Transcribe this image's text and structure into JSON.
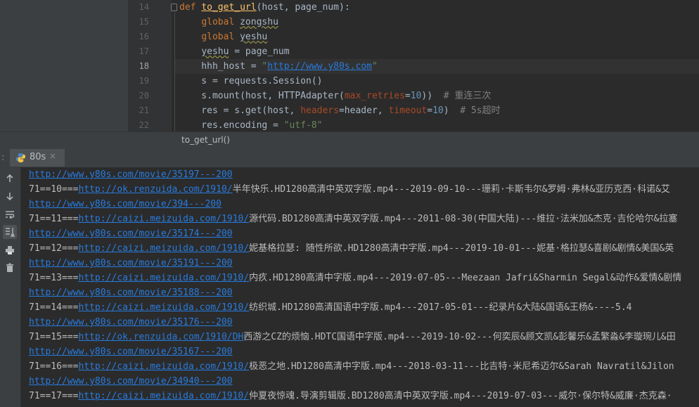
{
  "editor": {
    "lines": [
      {
        "num": "14",
        "tokens": [
          [
            "kw",
            "def "
          ],
          [
            "fn",
            "to_get_url"
          ],
          [
            "plain",
            "(host, page_num):"
          ]
        ]
      },
      {
        "num": "15",
        "tokens": [
          [
            "plain",
            "    "
          ],
          [
            "kw",
            "global "
          ],
          [
            "glob",
            "zongshu"
          ]
        ]
      },
      {
        "num": "16",
        "tokens": [
          [
            "plain",
            "    "
          ],
          [
            "kw",
            "global "
          ],
          [
            "glob",
            "yeshu"
          ]
        ]
      },
      {
        "num": "17",
        "tokens": [
          [
            "plain",
            "    "
          ],
          [
            "glob",
            "yeshu"
          ],
          [
            "plain",
            " = page_num"
          ]
        ]
      },
      {
        "num": "18",
        "current": true,
        "tokens": [
          [
            "plain",
            "    hhh_host = "
          ],
          [
            "str",
            "\""
          ],
          [
            "url",
            "http://www.y80s.com"
          ],
          [
            "str",
            "\""
          ]
        ]
      },
      {
        "num": "19",
        "tokens": [
          [
            "plain",
            "    s = requests.Session()"
          ]
        ]
      },
      {
        "num": "20",
        "tokens": [
          [
            "plain",
            "    s.mount(host, HTTPAdapter("
          ],
          [
            "param",
            "max_retries"
          ],
          [
            "plain",
            "="
          ],
          [
            "num",
            "10"
          ],
          [
            "plain",
            "))  "
          ],
          [
            "cmt",
            "# 重连三次"
          ]
        ]
      },
      {
        "num": "21",
        "tokens": [
          [
            "plain",
            "    res = s.get(host, "
          ],
          [
            "param",
            "headers"
          ],
          [
            "plain",
            "=header, "
          ],
          [
            "param",
            "timeout"
          ],
          [
            "plain",
            "="
          ],
          [
            "num",
            "10"
          ],
          [
            "plain",
            ")  "
          ],
          [
            "cmt",
            "# 5s超时"
          ]
        ]
      },
      {
        "num": "22",
        "tokens": [
          [
            "plain",
            "    res.encoding = "
          ],
          [
            "str",
            "\"utf-8\""
          ]
        ]
      }
    ]
  },
  "breadcrumb": "to_get_url()",
  "run_tab": {
    "label": "80s",
    "close": "×"
  },
  "toolbar": [
    "up-arrow-icon",
    "down-arrow-icon",
    "soft-wrap-icon",
    "scroll-to-end-icon",
    "print-icon",
    "trash-icon"
  ],
  "console": [
    [
      [
        "link",
        "http://www.y80s.com/movie/35197---200"
      ]
    ],
    [
      [
        "text",
        "71==10==="
      ],
      [
        "link",
        "http://ok.renzuida.com/1910/"
      ],
      [
        "text",
        "半年快乐.HD1280高清中英双字版.mp4---2019-09-10---珊莉·卡斯韦尔&罗姆·弗林&亚历克西·科诺&艾"
      ]
    ],
    [
      [
        "link",
        "http://www.y80s.com/movie/394---200"
      ]
    ],
    [
      [
        "text",
        "71==11==="
      ],
      [
        "link",
        "http://caizi.meizuida.com/1910/"
      ],
      [
        "text",
        "源代码.BD1280高清中英双字版.mp4---2011-08-30(中国大陆)---维拉·法米加&杰克·吉伦哈尔&拉塞"
      ]
    ],
    [
      [
        "link",
        "http://www.y80s.com/movie/35174---200"
      ]
    ],
    [
      [
        "text",
        "71==12==="
      ],
      [
        "link",
        "http://caizi.meizuida.com/1910/"
      ],
      [
        "text",
        "妮基格拉瑟: 随性所欲.HD1280高清中字版.mp4---2019-10-01---妮基·格拉瑟&喜剧&剧情&美国&英"
      ]
    ],
    [
      [
        "link",
        "http://www.y80s.com/movie/35191---200"
      ]
    ],
    [
      [
        "text",
        "71==13==="
      ],
      [
        "link",
        "http://caizi.meizuida.com/1910/"
      ],
      [
        "text",
        "内疚.HD1280高清中字版.mp4---2019-07-05---Meezaan Jafri&Sharmin Segal&动作&爱情&剧情"
      ]
    ],
    [
      [
        "link",
        "http://www.y80s.com/movie/35188---200"
      ]
    ],
    [
      [
        "text",
        "71==14==="
      ],
      [
        "link",
        "http://caizi.meizuida.com/1910/"
      ],
      [
        "text",
        "纺织城.HD1280高清国语中字版.mp4---2017-05-01---纪录片&大陆&国语&王杨&----5.4"
      ]
    ],
    [
      [
        "link",
        "http://www.y80s.com/movie/35176---200"
      ]
    ],
    [
      [
        "text",
        "71==15==="
      ],
      [
        "link",
        "http://ok.renzuida.com/1910/DH"
      ],
      [
        "text",
        "西游之CZ的烦恼.HDTC国语中字版.mp4---2019-10-02---何奕辰&顾文凯&彭馨乐&孟繁淼&李璇琬儿&田"
      ]
    ],
    [
      [
        "link",
        "http://www.y80s.com/movie/35167---200"
      ]
    ],
    [
      [
        "text",
        "71==16==="
      ],
      [
        "link",
        "http://caizi.meizuida.com/1910/"
      ],
      [
        "text",
        "极恶之地.HD1280高清中字版.mp4---2018-03-11---比吉特·米尼希迈尔&Sarah Navratil&Jilon"
      ]
    ],
    [
      [
        "link",
        "http://www.y80s.com/movie/34940---200"
      ]
    ],
    [
      [
        "text",
        "71==17==="
      ],
      [
        "link",
        "http://caizi.meizuida.com/1910/"
      ],
      [
        "text",
        "仲夏夜惊魂.导演剪辑版.BD1280高清中英双字版.mp4---2019-07-03---威尔·保尔特&威廉·杰克森·"
      ]
    ]
  ]
}
